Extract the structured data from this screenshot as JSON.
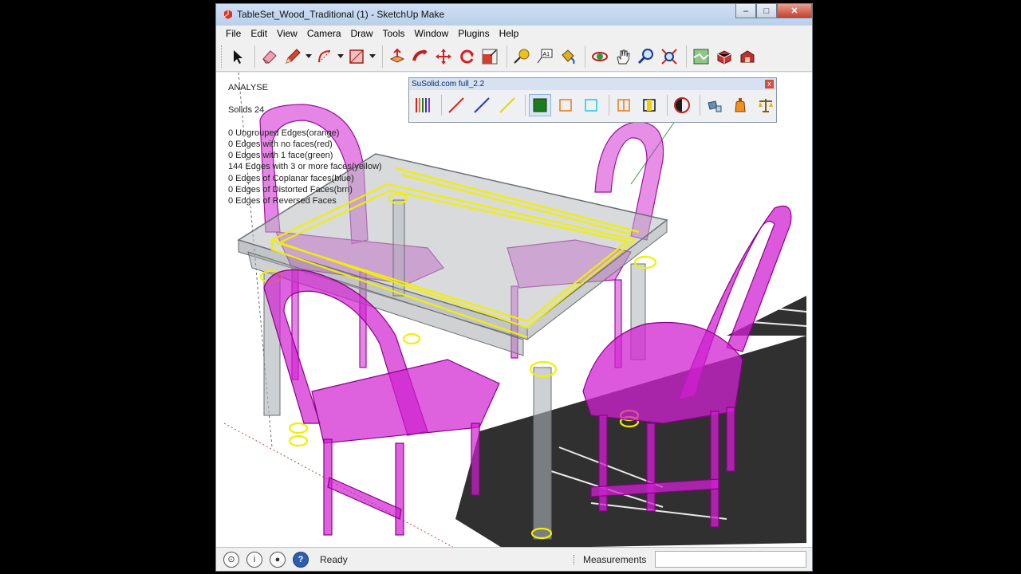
{
  "window": {
    "title": "TableSet_Wood_Traditional (1) - SketchUp Make",
    "minimize_label": "–",
    "maximize_label": "□",
    "close_label": "✕"
  },
  "menu": [
    "File",
    "Edit",
    "View",
    "Camera",
    "Draw",
    "Tools",
    "Window",
    "Plugins",
    "Help"
  ],
  "toolbar": {
    "tools": [
      "select",
      "eraser",
      "pencil",
      "arc",
      "rectangle",
      "push-pull",
      "follow-me",
      "move",
      "rotate",
      "scale",
      "tape-measure",
      "text",
      "paint-bucket",
      "orbit",
      "pan",
      "zoom",
      "zoom-extents",
      "previous-view",
      "add-location",
      "share-model"
    ]
  },
  "analyse": {
    "heading": "ANALYSE",
    "solids": "Solids 24",
    "lines": [
      "0 Ungrouped Edges(orange)",
      "0 Edges with no faces(red)",
      "0 Edges with 1 face(green)",
      "144 Edges with 3 or more faces(yellow)",
      "0 Edges of Coplanar faces(blue)",
      "0 Edges of Distorted Faces(brn)",
      "0 Edges of Reversed Faces"
    ]
  },
  "palette": {
    "title": "SuSolid.com full_2.2",
    "close_label": "x",
    "tool_colors": {
      "red": "#e02020",
      "blue": "#3030d0",
      "yellow": "#e8d400",
      "green": "#1e7a1e",
      "orange": "#e87a10",
      "cyan": "#20c8e0"
    }
  },
  "scene": {
    "solid_color": "#d020d0",
    "edge_highlight": "#f0f000",
    "glass_color": "#b8bcc0"
  },
  "status": {
    "text": "Ready",
    "measurements_label": "Measurements",
    "measurements_value": ""
  }
}
